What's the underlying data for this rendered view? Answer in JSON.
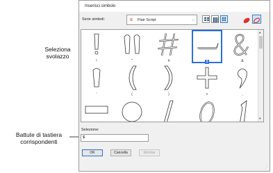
{
  "dialog": {
    "title": "Inserisci simbolo"
  },
  "font_selector": {
    "label": "Serie simboli:",
    "value": "Flair Script",
    "icon": "flair-script-icon",
    "accent": "#d01a1a"
  },
  "toolbar": {
    "buttons": [
      {
        "name": "list-view-button",
        "icon": "list-view-icon"
      },
      {
        "name": "large-grid-button",
        "icon": "large-grid-icon"
      },
      {
        "name": "small-grid-button",
        "icon": "small-grid-icon",
        "selected": true
      },
      {
        "name": "color-picker-button",
        "icon": "color-icon"
      },
      {
        "name": "outline-color-button",
        "icon": "outline-color-icon"
      }
    ]
  },
  "symbols": [
    {
      "glyph": "!",
      "caption": "!"
    },
    {
      "glyph": "\"",
      "caption": "\""
    },
    {
      "glyph": "#",
      "caption": "#"
    },
    {
      "glyph": "$",
      "caption": "$",
      "selected": true
    },
    {
      "glyph": "&",
      "caption": "&"
    },
    {
      "glyph": "'",
      "caption": "'"
    },
    {
      "glyph": "(",
      "caption": "("
    },
    {
      "glyph": ")",
      "caption": ")"
    },
    {
      "glyph": "+",
      "caption": "+"
    },
    {
      "glyph": ",",
      "caption": ","
    },
    {
      "glyph": "-",
      "caption": ""
    },
    {
      "glyph": ".",
      "caption": ""
    },
    {
      "glyph": "/",
      "caption": ""
    },
    {
      "glyph": "0",
      "caption": ""
    },
    {
      "glyph": "1",
      "caption": ""
    }
  ],
  "selection": {
    "label": "Selezione:",
    "value": "$"
  },
  "buttons": {
    "ok": "OK",
    "cancel": "Cancella",
    "clear": "Elimina"
  },
  "callouts": {
    "swash": "Seleziona\nsvolazzo",
    "keystrokes": "Battute di tastiera\ncorrispondenti"
  }
}
